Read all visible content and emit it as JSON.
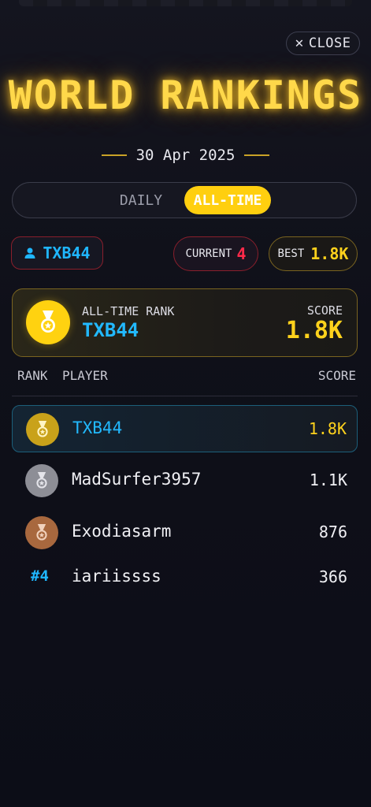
{
  "header": {
    "close_label": "CLOSE",
    "title": "WORLD RANKINGS",
    "date": "30 Apr 2025"
  },
  "tabs": [
    {
      "label": "DAILY",
      "selected": false
    },
    {
      "label": "ALL-TIME",
      "selected": true
    }
  ],
  "stats": {
    "username": "TXB44",
    "current_label": "CURRENT",
    "current_value": "4",
    "best_label": "BEST",
    "best_value": "1.8K"
  },
  "rank_card": {
    "label": "ALL-TIME RANK",
    "name": "TXB44",
    "score_label": "SCORE",
    "score_value": "1.8K"
  },
  "table": {
    "headers": {
      "rank": "RANK",
      "player": "PLAYER",
      "score": "SCORE"
    },
    "rows": [
      {
        "rank_display": "",
        "medal": "gold",
        "player": "TXB44",
        "score": "1.8K",
        "is_me": true
      },
      {
        "rank_display": "",
        "medal": "silver",
        "player": "MadSurfer3957",
        "score": "1.1K",
        "is_me": false
      },
      {
        "rank_display": "",
        "medal": "bronze",
        "player": "Exodiasarm",
        "score": "876",
        "is_me": false
      },
      {
        "rank_display": "#4",
        "medal": "",
        "player": "iariissss",
        "score": "366",
        "is_me": false
      }
    ]
  },
  "colors": {
    "accent_gold": "#ffd21c",
    "accent_blue": "#22b9ff",
    "accent_red": "#ff2a4a",
    "background": "#0e0f1a"
  },
  "icons": {
    "close": "close-icon",
    "user": "user-icon",
    "medal": "medal-icon"
  }
}
